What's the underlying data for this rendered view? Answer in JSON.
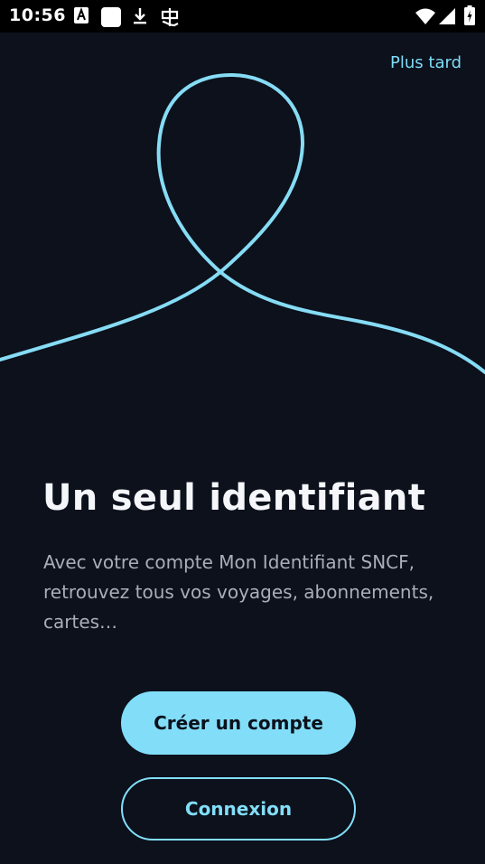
{
  "status_bar": {
    "time": "10:56",
    "icons": [
      "font-a-icon",
      "blank-square-icon",
      "download-icon",
      "app-glyph-icon",
      "wifi-icon",
      "signal-icon",
      "battery-icon"
    ]
  },
  "header": {
    "later_label": "Plus tard"
  },
  "hero": {
    "illustration_icon": "loop-line-illustration",
    "title": "Un seul identifiant",
    "description": "Avec votre compte Mon Identifiant SNCF, retrouvez tous vos voyages, abonnements, cartes…"
  },
  "actions": {
    "create_label": "Créer un compte",
    "login_label": "Connexion"
  },
  "colors": {
    "background": "#0c111c",
    "accent": "#82def8",
    "title": "#f4f6f9",
    "body_text": "#a9aeb8"
  }
}
